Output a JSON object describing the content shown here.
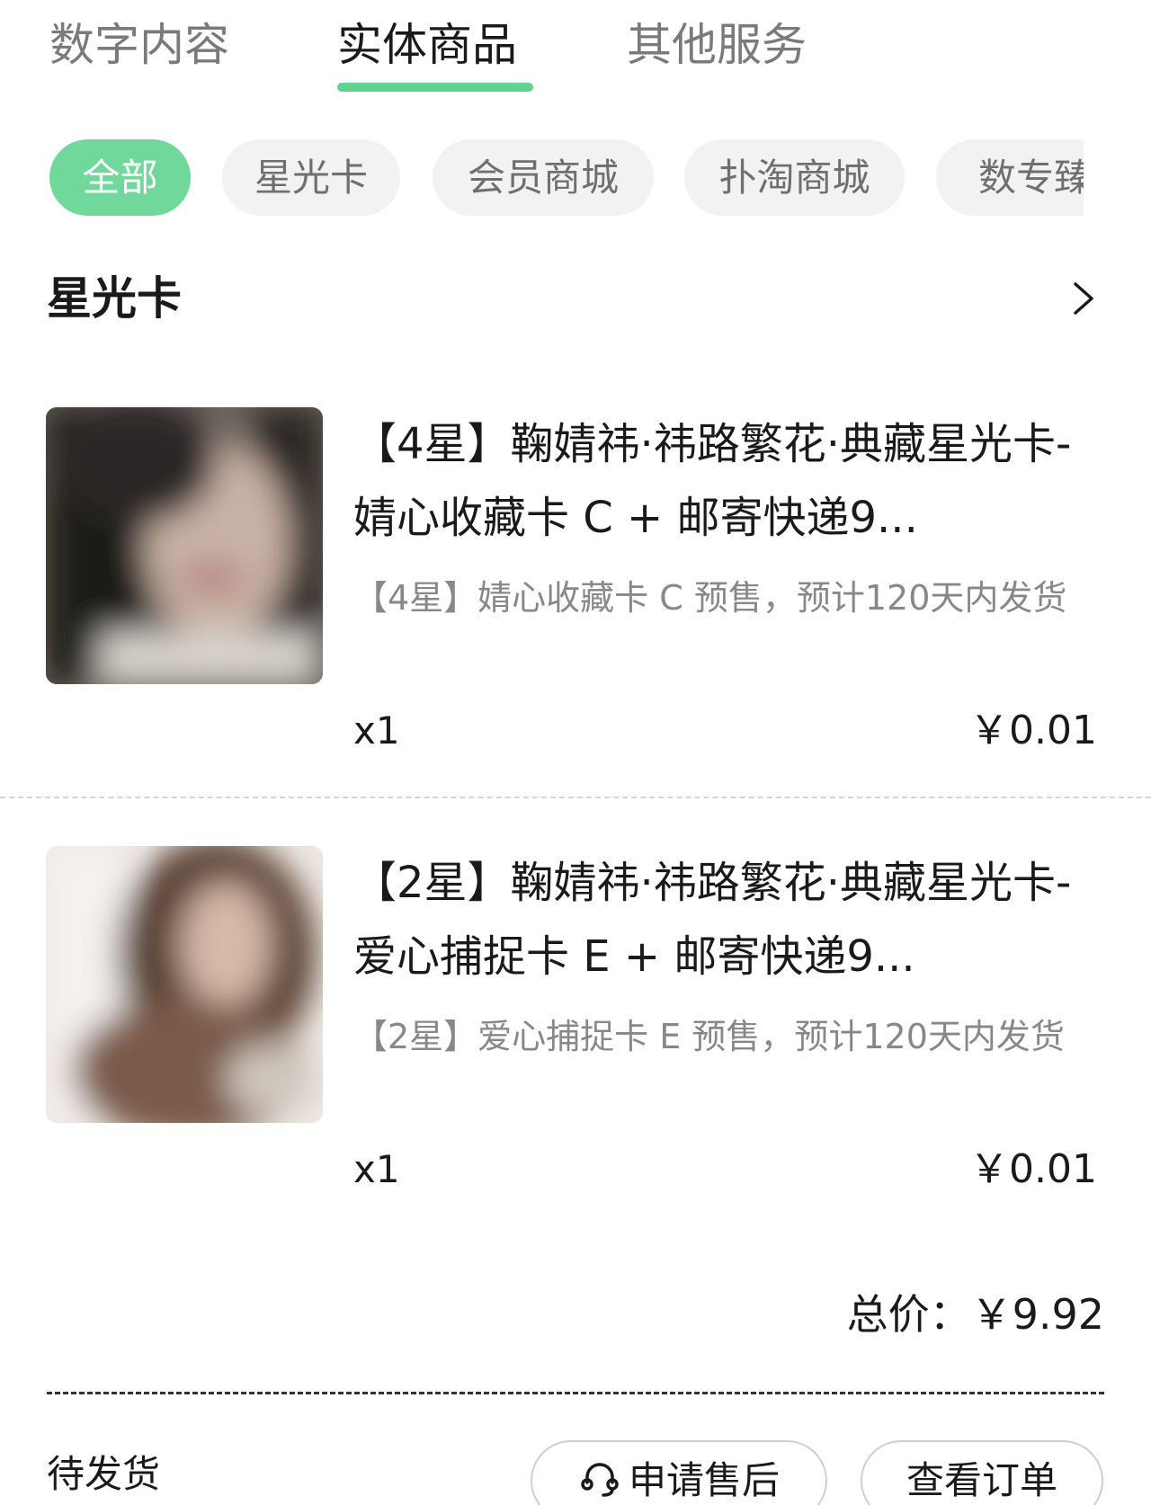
{
  "tabs": [
    {
      "label": "数字内容"
    },
    {
      "label": "实体商品"
    },
    {
      "label": "其他服务"
    }
  ],
  "filters": [
    {
      "label": "全部"
    },
    {
      "label": "星光卡"
    },
    {
      "label": "会员商城"
    },
    {
      "label": "扑淘商城"
    },
    {
      "label": "数专臻"
    }
  ],
  "section": {
    "title": "星光卡",
    "icon": "chevron-right-icon"
  },
  "items": [
    {
      "title": "【4星】鞠婧祎·祎路繁花·典藏星光卡-婧心收藏卡 C + 邮寄快递9...",
      "desc": "【4星】婧心收藏卡 C 预售，预计120天内发货",
      "qty": "x1",
      "price": "￥0.01"
    },
    {
      "title": "【2星】鞠婧祎·祎路繁花·典藏星光卡-爱心捕捉卡 E + 邮寄快递9...",
      "desc": "【2星】爱心捕捉卡 E 预售，预计120天内发货",
      "qty": "x1",
      "price": "￥0.01"
    }
  ],
  "total": {
    "label": "总价：",
    "value": "￥9.92"
  },
  "order": {
    "status": "待发货",
    "after_sale_label": "申请售后",
    "after_sale_icon": "headset-icon",
    "view_order_label": "查看订单"
  },
  "colors": {
    "accent": "#5fd38f",
    "chip_active": "#6fd89a",
    "chip_bg": "#f2f2f2",
    "muted_text": "#888888"
  }
}
